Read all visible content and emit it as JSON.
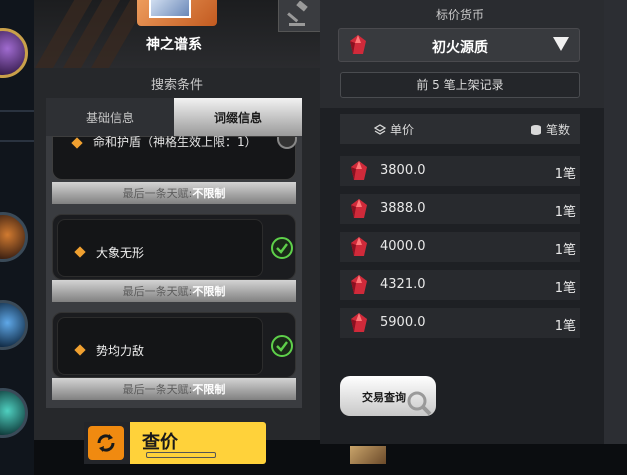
{
  "left_panel": {
    "series_title": "神之谱系",
    "search_conditions_title": "搜索条件",
    "tabs": [
      {
        "label": "基础信息",
        "active": false
      },
      {
        "label": "词缀信息",
        "active": true
      }
    ],
    "partial_affix": {
      "label": "命和护盾（神格生效上限：1）"
    },
    "footer_prefix": "最后一条天赋:",
    "footer_value": "不限制",
    "affixes": [
      {
        "label": "大象无形",
        "checked": true
      },
      {
        "label": "势均力敌",
        "checked": true
      }
    ],
    "query_button_label": "查价"
  },
  "right_panel": {
    "currency_title": "标价货币",
    "currency_selected": "初火源质",
    "records_button": "前 5 笔上架记录",
    "table_headers": {
      "price": "单价",
      "count": "笔数"
    },
    "rows": [
      {
        "price": "3800.0",
        "count": "1笔"
      },
      {
        "price": "3888.0",
        "count": "1笔"
      },
      {
        "price": "4000.0",
        "count": "1笔"
      },
      {
        "price": "4321.0",
        "count": "1笔"
      },
      {
        "price": "5900.0",
        "count": "1笔"
      }
    ],
    "trade_button": "交易查询"
  },
  "icons": {
    "gavel": "gavel-icon",
    "gem": "red-crystal-icon",
    "refresh": "refresh-icon",
    "search": "magnifier-icon",
    "check": "check-circle-icon",
    "coins": "coin-stack-icon",
    "layers": "layers-icon"
  },
  "colors": {
    "accent_orange": "#f0a030",
    "query_yellow": "#ffd23a",
    "check_green": "#5ed04a",
    "gem_red": "#d02a3a"
  }
}
